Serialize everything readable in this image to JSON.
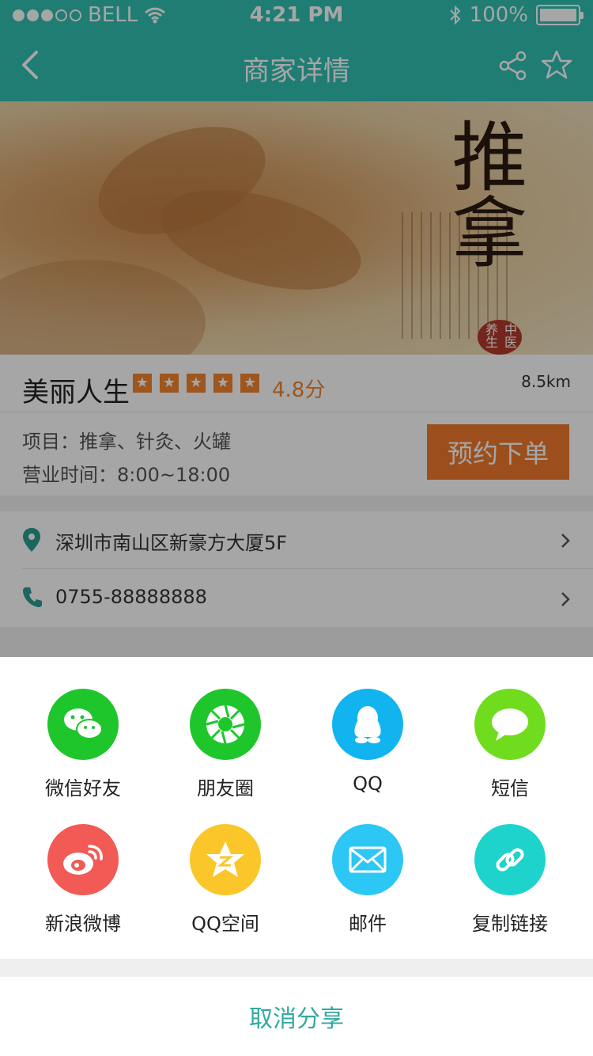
{
  "status_bar": {
    "carrier": "BELL",
    "time": "4:21 PM",
    "battery": "100%"
  },
  "nav": {
    "title": "商家详情"
  },
  "banner": {
    "calligraphy": "推拿",
    "seal": "中医养生"
  },
  "shop": {
    "name": "美丽人生",
    "rating_stars": 5,
    "score": "4.8分",
    "distance": "8.5km",
    "projects": "项目：推拿、针灸、火罐",
    "hours": "营业时间：8:00~18:00",
    "book_label": "预约下单"
  },
  "contact": {
    "address": "深圳市南山区新豪方大厦5F",
    "phone": "0755-88888888"
  },
  "share_sheet": {
    "items": [
      {
        "label": "微信好友",
        "icon": "wechat-icon",
        "color": "#1ec62c"
      },
      {
        "label": "朋友圈",
        "icon": "moments-icon",
        "color": "#1ec62c"
      },
      {
        "label": "QQ",
        "icon": "qq-icon",
        "color": "#12b4f0"
      },
      {
        "label": "短信",
        "icon": "sms-icon",
        "color": "#6fdc1e"
      },
      {
        "label": "新浪微博",
        "icon": "weibo-icon",
        "color": "#f25a55"
      },
      {
        "label": "QQ空间",
        "icon": "qzone-icon",
        "color": "#fac62a"
      },
      {
        "label": "邮件",
        "icon": "mail-icon",
        "color": "#2cc7f4"
      },
      {
        "label": "复制链接",
        "icon": "link-icon",
        "color": "#1ed3cc"
      }
    ],
    "cancel_label": "取消分享"
  },
  "colors": {
    "primary": "#32c0b2",
    "accent": "#f07a2b",
    "cancel": "#32aaa0"
  }
}
